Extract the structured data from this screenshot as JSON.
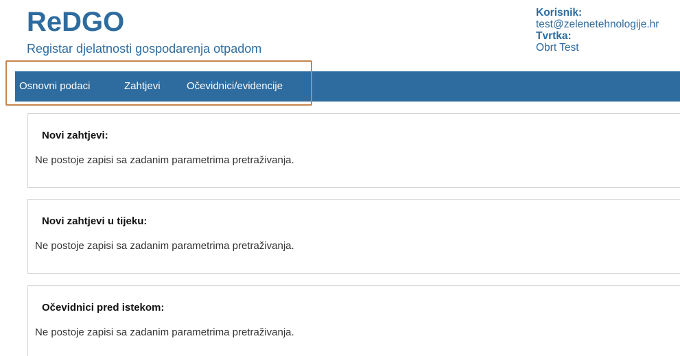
{
  "header": {
    "title": "ReDGO",
    "subtitle": "Registar djelatnosti gospodarenja otpadom"
  },
  "user_info": {
    "user_label": "Korisnik:",
    "user_value": "test@zelenetehnologije.hr",
    "company_label": "Tvrtka:",
    "company_value": "Obrt Test"
  },
  "nav": {
    "items": [
      {
        "label": "Osnovni podaci"
      },
      {
        "label": "Zahtjevi"
      },
      {
        "label": "Očevidnici/evidencije"
      }
    ]
  },
  "panels": [
    {
      "title": "Novi zahtjevi:",
      "text": "Ne postoje zapisi sa zadanim parametrima pretraživanja."
    },
    {
      "title": "Novi zahtjevi u tijeku:",
      "text": "Ne postoje zapisi sa zadanim parametrima pretraživanja."
    },
    {
      "title": "Očevidnici pred istekom:",
      "text": "Ne postoje zapisi sa zadanim parametrima pretraživanja."
    }
  ],
  "colors": {
    "brand": "#2e6b9e",
    "highlight": "#c8844a",
    "panel_border": "#d4d4d4"
  }
}
